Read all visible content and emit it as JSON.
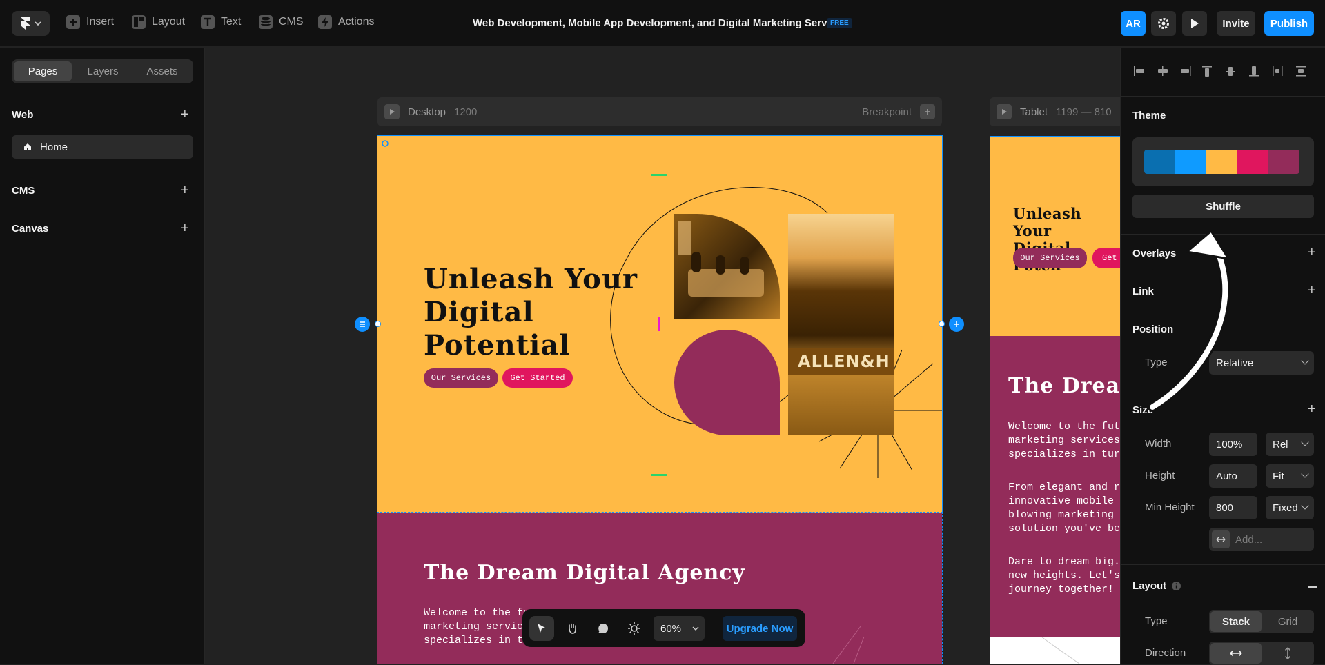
{
  "topbar": {
    "items": [
      {
        "label": "Insert",
        "icon": "plus-square-icon"
      },
      {
        "label": "Layout",
        "icon": "layout-icon"
      },
      {
        "label": "Text",
        "icon": "text-icon"
      },
      {
        "label": "CMS",
        "icon": "database-icon"
      },
      {
        "label": "Actions",
        "icon": "lightning-icon"
      }
    ],
    "project_title": "Web Development, Mobile App Development, and Digital Marketing Services",
    "plan_badge": "FREE",
    "avatar_initials": "AR",
    "invite_label": "Invite",
    "publish_label": "Publish"
  },
  "left_panel": {
    "tabs": [
      "Pages",
      "Layers",
      "Assets"
    ],
    "active_tab": "Pages",
    "sections": [
      {
        "title": "Web"
      },
      {
        "title": "CMS"
      },
      {
        "title": "Canvas"
      }
    ],
    "pages": [
      {
        "label": "Home",
        "icon": "home-icon"
      }
    ]
  },
  "canvas": {
    "desktop": {
      "name": "Desktop",
      "width": "1200",
      "breakpoint_label": "Breakpoint"
    },
    "tablet": {
      "name": "Tablet",
      "range": "1199 — 810"
    },
    "hero": {
      "title_lines": [
        "Unleash Your",
        "Digital",
        "Potential"
      ],
      "btn_services": "Our Services",
      "btn_started": "Get Started",
      "tablet_title_lines": [
        "Unleash Your",
        "Digital Poten"
      ],
      "tablet_btn_started": "Get"
    },
    "building_sign": "ALLEN&H",
    "agency": {
      "title": "The Dream Digital Agency",
      "tablet_title": "The Drean",
      "desktop_para": "Welcome to the fu\nmarketing service\nspecializes in tu",
      "tablet_para1": "Welcome to the futur\nmarketing services!\nspecializes in turni",
      "tablet_para2": "From elegant and re\ninnovative mobile ap\nblowing marketing st\nsolution you've been",
      "tablet_para3": "Dare to dream big.\nnew heights. Let's\njourney together!"
    }
  },
  "toolbar": {
    "tools": [
      "pointer-icon",
      "hand-icon",
      "comment-icon",
      "sun-icon"
    ],
    "zoom": "60%",
    "upgrade_label": "Upgrade Now"
  },
  "right_panel": {
    "theme": {
      "title": "Theme",
      "colors": [
        "#0a6fb0",
        "#0f9bff",
        "#ffba45",
        "#e0165e",
        "#932c5a"
      ],
      "shuffle_label": "Shuffle"
    },
    "overlays_label": "Overlays",
    "link_label": "Link",
    "position": {
      "title": "Position",
      "type_label": "Type",
      "type_value": "Relative"
    },
    "size": {
      "title": "Size",
      "width_label": "Width",
      "width_value": "100%",
      "width_unit": "Rel",
      "height_label": "Height",
      "height_value": "Auto",
      "height_unit": "Fit",
      "minh_label": "Min Height",
      "minh_value": "800",
      "minh_unit": "Fixed",
      "add_placeholder": "Add..."
    },
    "layout": {
      "title": "Layout",
      "type_label": "Type",
      "type_options": [
        "Stack",
        "Grid"
      ],
      "type_active": "Stack",
      "direction_label": "Direction"
    }
  },
  "colors": {
    "accent": "#0f8fff",
    "hero_bg": "#ffba45",
    "agency_bg": "#932c5a",
    "pink": "#e0165e"
  }
}
